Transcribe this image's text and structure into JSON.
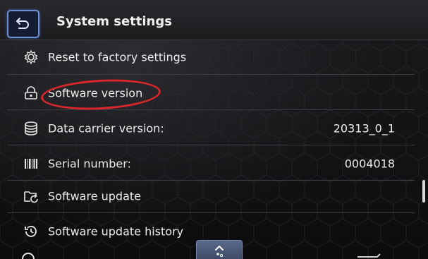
{
  "header": {
    "title": "System settings"
  },
  "menu": {
    "items": [
      {
        "label": "Reset to factory settings",
        "value": "",
        "icon": "reset-gear-icon"
      },
      {
        "label": "Software version",
        "value": "",
        "icon": "lock-icon"
      },
      {
        "label": "Data carrier version:",
        "value": "20313_0_1",
        "icon": "database-icon"
      },
      {
        "label": "Serial number:",
        "value": "0004018",
        "icon": "barcode-icon"
      },
      {
        "label": "Software update",
        "value": "",
        "icon": "folder-refresh-icon"
      },
      {
        "label": "Software update history",
        "value": "",
        "icon": "history-icon"
      }
    ]
  },
  "colors": {
    "accent": "#6f8fd6",
    "highlight": "#d8262b",
    "text": "#ececec",
    "background": "#141416"
  }
}
